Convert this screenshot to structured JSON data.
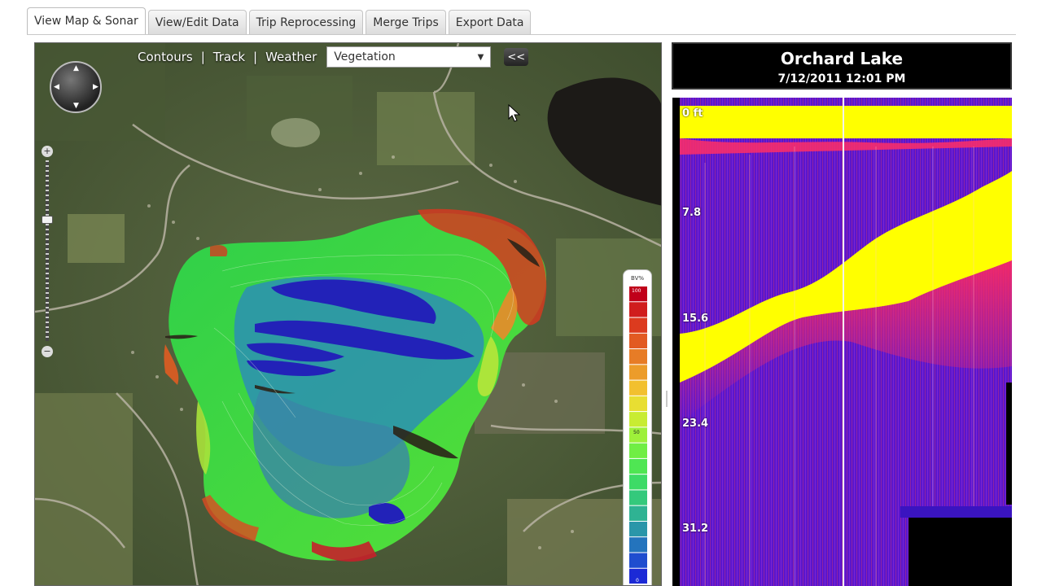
{
  "tabs": [
    {
      "label": "View Map & Sonar",
      "active": true
    },
    {
      "label": "View/Edit Data",
      "active": false
    },
    {
      "label": "Trip Reprocessing",
      "active": false
    },
    {
      "label": "Merge Trips",
      "active": false
    },
    {
      "label": "Export Data",
      "active": false
    }
  ],
  "map": {
    "layers": [
      "Contours",
      "Track",
      "Weather"
    ],
    "separator": "|",
    "layer_select": {
      "value": "Vegetation"
    },
    "collapse_label": "<<",
    "legend": {
      "title": "BV%",
      "top_label": "100",
      "mid_label": "50",
      "bottom_label": "0",
      "colors": [
        "#c0001a",
        "#d01d1d",
        "#dc3b1f",
        "#e25a22",
        "#e77c26",
        "#ec9c2a",
        "#f2c02f",
        "#e8de32",
        "#c8ec33",
        "#9ef03a",
        "#70ee44",
        "#4fe653",
        "#3ddb66",
        "#34c97c",
        "#2fb393",
        "#2a96a9",
        "#2474bd",
        "#1f4dcf",
        "#1c2ad6"
      ]
    },
    "icons": {
      "pan": "pan-control-icon",
      "zoom_in": "zoom-in-icon",
      "zoom_out": "zoom-out-icon"
    }
  },
  "sonar": {
    "lake_name": "Orchard Lake",
    "datetime": "7/12/2011 12:01 PM",
    "depth_labels": [
      "0 ft",
      "7.8",
      "15.6",
      "23.4",
      "31.2"
    ]
  },
  "colors": {
    "sonar_yellow": "#ffff00",
    "sonar_purple": "#6a12d8",
    "sonar_red": "#ff1f55"
  }
}
